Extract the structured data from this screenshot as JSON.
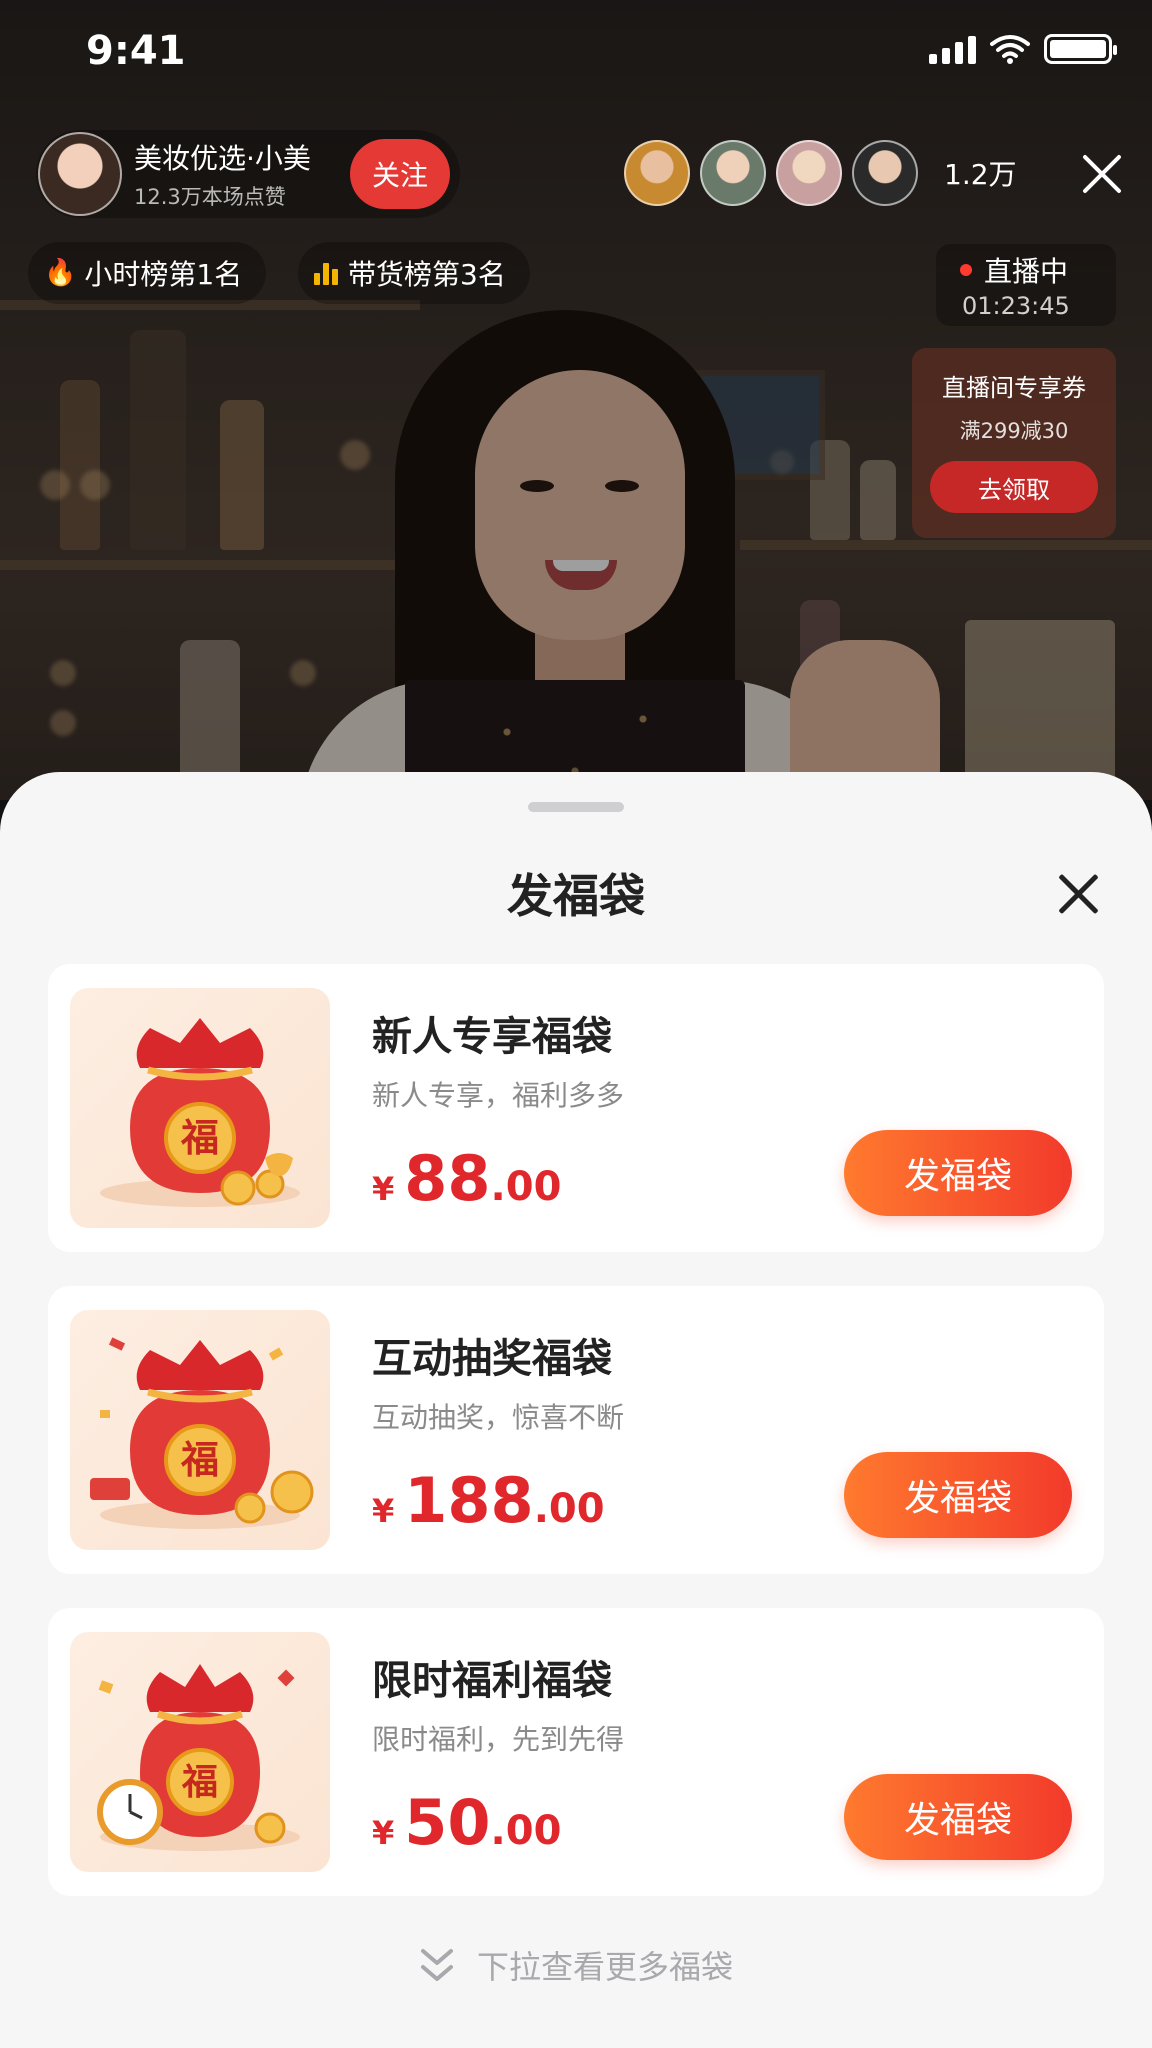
{
  "status_bar": {
    "time": "9:41"
  },
  "anchor": {
    "name": "美妆优选·小美",
    "likes": "12.3万本场点赞",
    "follow_label": "关注"
  },
  "viewers": {
    "count": "1.2万"
  },
  "ranks": [
    {
      "icon": "fire-icon",
      "label": "小时榜第1名"
    },
    {
      "icon": "bar-chart-icon",
      "label": "带货榜第3名"
    }
  ],
  "live": {
    "label": "直播中",
    "duration": "01:23:45"
  },
  "coupon": {
    "title": "直播间专享券",
    "desc": "满299减30",
    "button": "去领取"
  },
  "sheet": {
    "title": "发福袋",
    "items": [
      {
        "title": "新人专享福袋",
        "subtitle": "新人专享，福利多多",
        "currency": "¥",
        "price_int": "88",
        "price_dec": ".00",
        "button": "发福袋",
        "bag_label": "福"
      },
      {
        "title": "互动抽奖福袋",
        "subtitle": "互动抽奖，惊喜不断",
        "currency": "¥",
        "price_int": "188",
        "price_dec": ".00",
        "button": "发福袋",
        "bag_label": "福"
      },
      {
        "title": "限时福利福袋",
        "subtitle": "限时福利，先到先得",
        "currency": "¥",
        "price_int": "50",
        "price_dec": ".00",
        "button": "发福袋",
        "bag_label": "福"
      }
    ],
    "more_hint": "下拉查看更多福袋"
  },
  "colors": {
    "accent_red": "#e0282c",
    "button_start": "#ff7a2e",
    "button_end": "#f23a2b",
    "follow_red": "#e53935"
  }
}
